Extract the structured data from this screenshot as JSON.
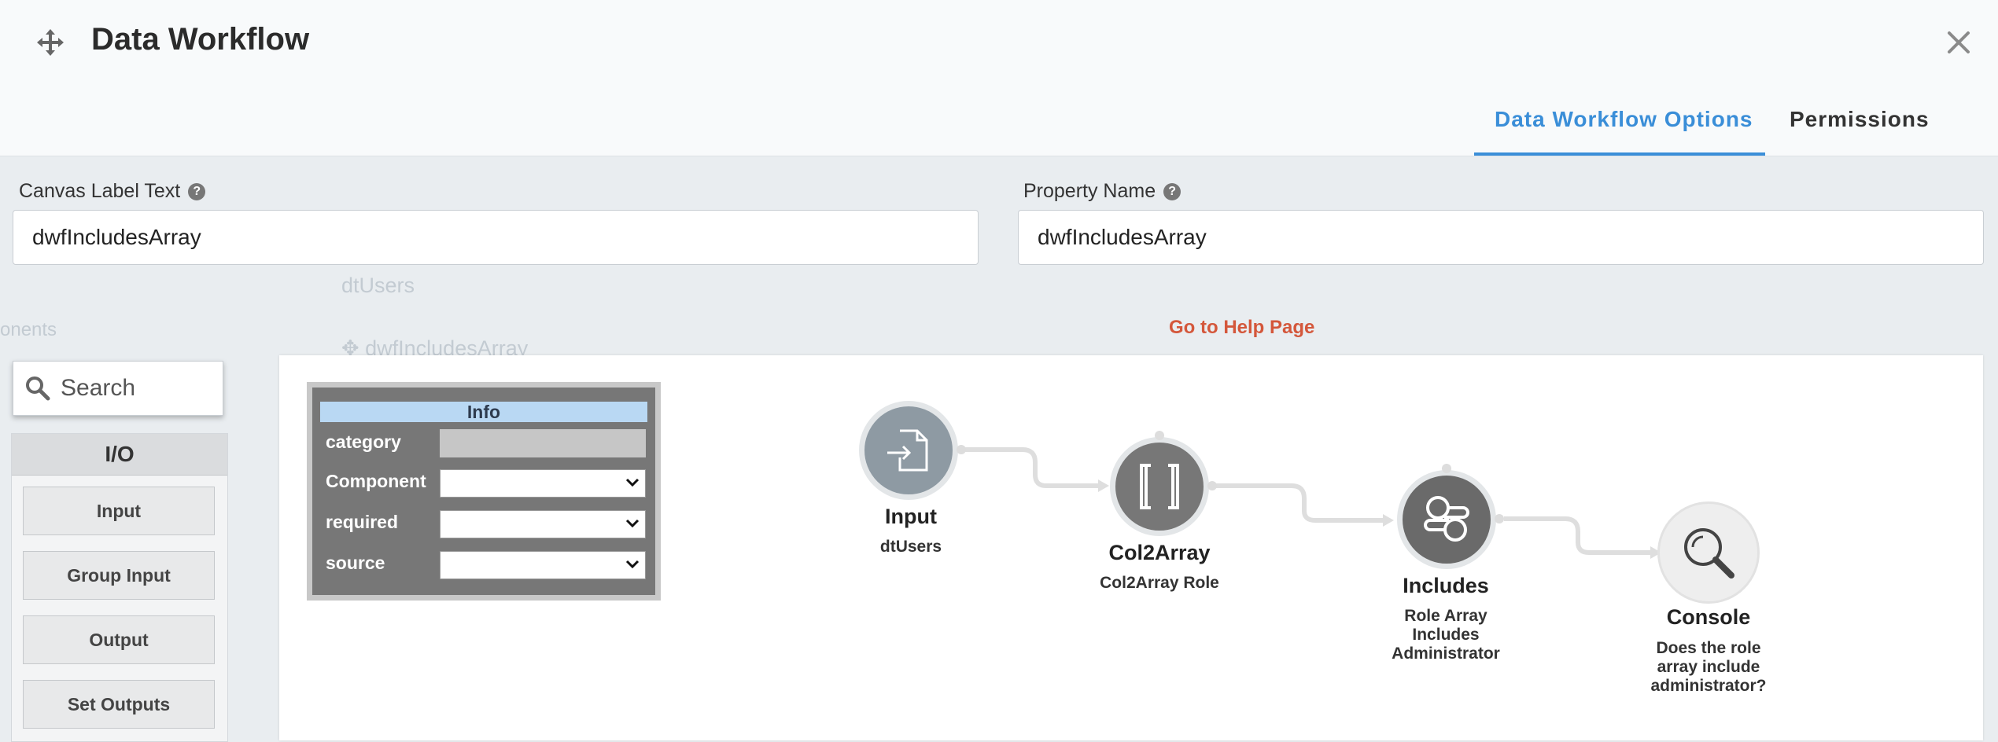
{
  "header": {
    "title": "Data Workflow",
    "tabs": [
      {
        "label": "Data Workflow Options",
        "active": true
      },
      {
        "label": "Permissions",
        "active": false
      }
    ],
    "accent_color": "#3a8ed8"
  },
  "background": {
    "item_1": "dtUsers",
    "item_2": "dwfIncludesArray",
    "item_3": "onents"
  },
  "form": {
    "canvas_label": {
      "label": "Canvas Label Text",
      "value": "dwfIncludesArray"
    },
    "property_name": {
      "label": "Property Name",
      "value": "dwfIncludesArray"
    },
    "help_link": "Go to Help Page",
    "help_icon_text": "?"
  },
  "palette": {
    "search_placeholder": "Search",
    "group_title": "I/O",
    "buttons": [
      "Input",
      "Group Input",
      "Output",
      "Set Outputs"
    ]
  },
  "info_box": {
    "title": "Info",
    "rows": [
      {
        "label": "category",
        "kind": "readonly",
        "value": ""
      },
      {
        "label": "Component",
        "kind": "select",
        "value": ""
      },
      {
        "label": "required",
        "kind": "select",
        "value": ""
      },
      {
        "label": "source",
        "kind": "select",
        "value": ""
      }
    ]
  },
  "nodes": [
    {
      "id": "input",
      "title": "Input",
      "subtitle": "dtUsers",
      "icon": "file-import-icon",
      "color": "#8e9aa3"
    },
    {
      "id": "col2array",
      "title": "Col2Array",
      "subtitle": "Col2Array Role",
      "icon": "brackets-icon",
      "color": "#777777"
    },
    {
      "id": "includes",
      "title": "Includes",
      "subtitle": "Role Array Includes Administrator",
      "icon": "filter-toggle-icon",
      "color": "#6a6a6a"
    },
    {
      "id": "console",
      "title": "Console",
      "subtitle": "Does the role array include administrator?",
      "icon": "magnifier-icon",
      "color": "#eeeeee"
    }
  ]
}
